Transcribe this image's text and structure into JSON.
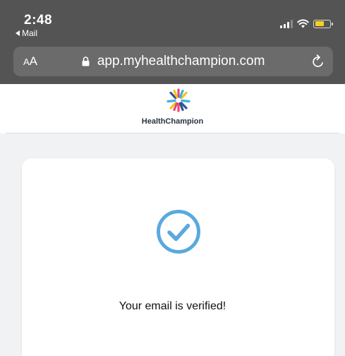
{
  "status_bar": {
    "time": "2:48",
    "back_app": "Mail"
  },
  "browser": {
    "text_size_label": "AA",
    "url": "app.myhealthchampion.com"
  },
  "site": {
    "brand_name": "HealthChampion",
    "logo_colors": [
      "#e8477a",
      "#f5c31c",
      "#39b3e6",
      "#2f5597"
    ]
  },
  "card": {
    "message": "Your email is verified!",
    "check_color": "#5aa9de"
  }
}
